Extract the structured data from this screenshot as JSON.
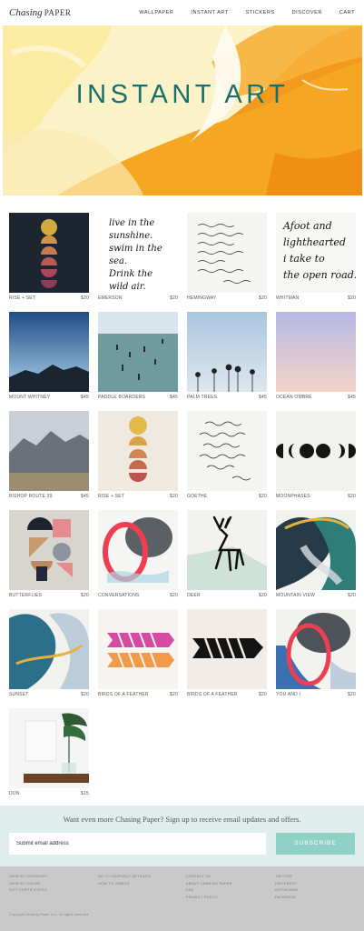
{
  "header": {
    "logo_script": "Chasing",
    "logo_caps": "PAPER",
    "nav": [
      "WALLPAPER",
      "INSTANT ART",
      "STICKERS",
      "DISCOVER",
      "CART"
    ]
  },
  "hero": {
    "title": "INSTANT ART"
  },
  "products": [
    {
      "name": "RISE + SET",
      "price": "$20"
    },
    {
      "name": "EMERSON",
      "price": "$20",
      "art_text": [
        "live in the",
        "sunshine.",
        "swim in the",
        "sea.",
        "Drink the",
        "wild air."
      ]
    },
    {
      "name": "HEMINGWAY",
      "price": "$20"
    },
    {
      "name": "WHITMAN",
      "price": "$20",
      "art_text": [
        "Afoot and",
        "lighthearted",
        "i take to",
        "the open road."
      ]
    },
    {
      "name": "MOUNT WHITNEY",
      "price": "$45"
    },
    {
      "name": "PADDLE BOARDERS",
      "price": "$45"
    },
    {
      "name": "PALM TREES",
      "price": "$45"
    },
    {
      "name": "OCEAN OMBRE",
      "price": "$45"
    },
    {
      "name": "BISHOP ROUTE 39",
      "price": "$45"
    },
    {
      "name": "RISE + SET",
      "price": "$20"
    },
    {
      "name": "GOETHE",
      "price": "$20"
    },
    {
      "name": "MOONPHASES",
      "price": "$20"
    },
    {
      "name": "BUTTERFLIES",
      "price": "$20"
    },
    {
      "name": "CONVERSATIONS",
      "price": "$20"
    },
    {
      "name": "DEER",
      "price": "$20"
    },
    {
      "name": "MOUNTAIN VIEW",
      "price": "$20"
    },
    {
      "name": "SUNSET",
      "price": "$20"
    },
    {
      "name": "BIRDS OF A FEATHER",
      "price": "$20"
    },
    {
      "name": "BIRDS OF A FEATHER",
      "price": "$20"
    },
    {
      "name": "YOU AND I",
      "price": "$20"
    },
    {
      "name": "DON",
      "price": "$15"
    }
  ],
  "signup": {
    "text": "Want even more Chasing Paper? Sign up to receive email updates and offers.",
    "placeholder": "Submit email address",
    "button": "SUBSCRIBE"
  },
  "footer": {
    "col1": [
      "VIEW BY CATEGORY",
      "VIEW BY COLOR",
      "GIFT CERTIFICATES"
    ],
    "col2": [
      "DO-IT-YOURSELF ARTICLES",
      "HOW TO VIDEOS"
    ],
    "col3": [
      "CONTACT US",
      "ABOUT CHASING PAPER",
      "FAQ",
      "PRIVACY POLICY"
    ],
    "col4": [
      "TWITTER",
      "PINTEREST",
      "INSTAGRAM",
      "FACEBOOK"
    ],
    "copyright": "Copyright Chasing Paper LLC. All rights reserved."
  },
  "colors": {
    "accent": "#1a6e6a",
    "subscribe": "#8fd1c4",
    "signup_bg": "#dfeeec",
    "footer_bg": "#c9c9c9"
  }
}
